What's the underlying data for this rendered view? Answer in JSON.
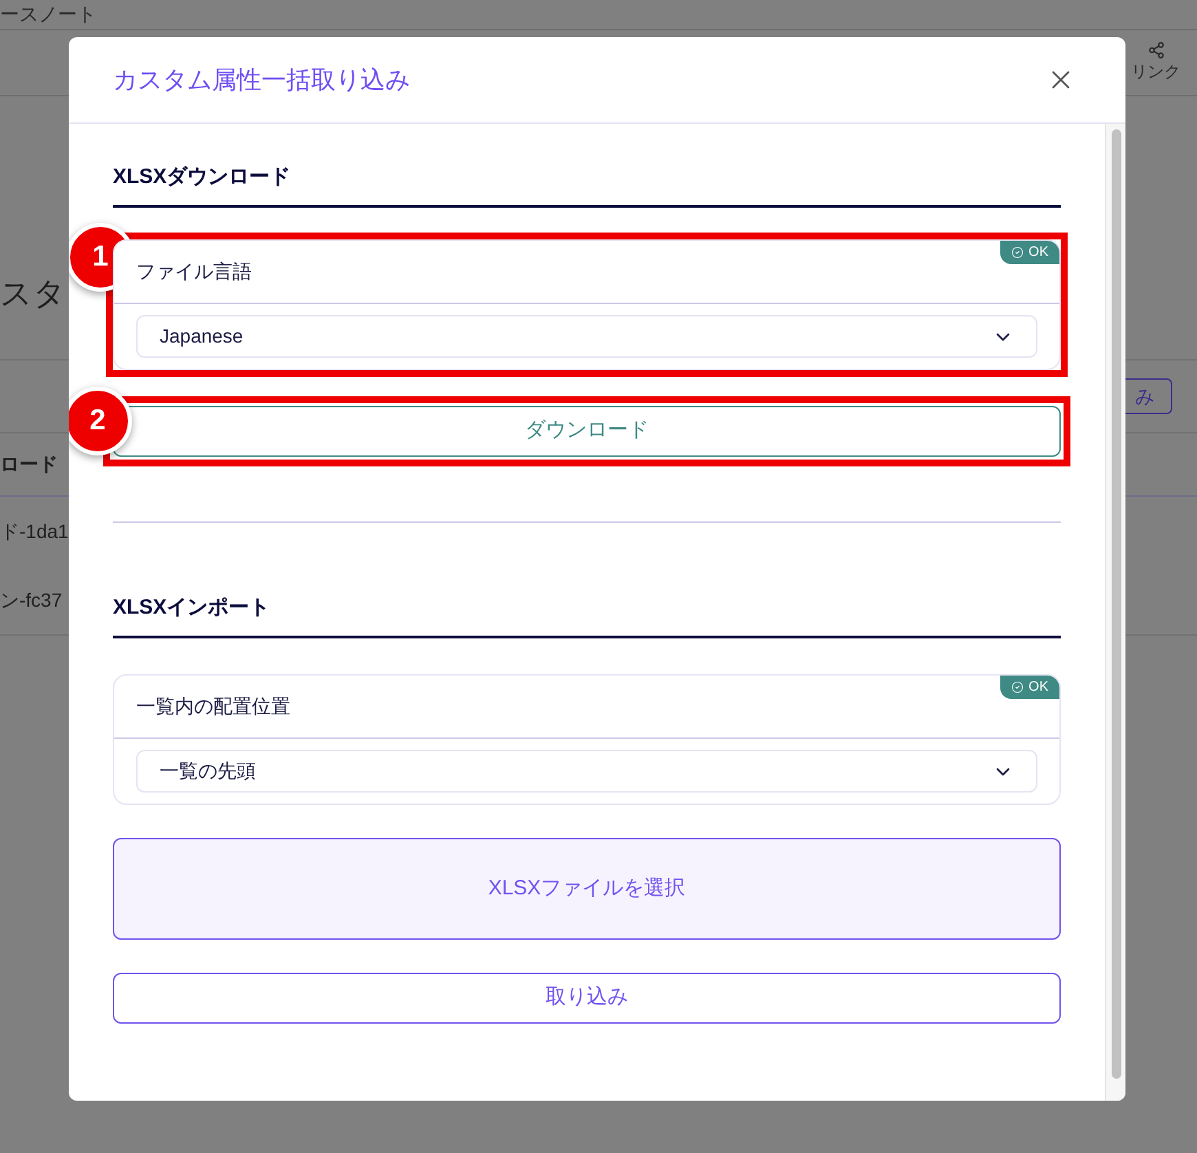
{
  "background": {
    "breadcrumb": "ースノート",
    "share_label": "リンク",
    "heading": "スタ",
    "action_button": "み",
    "table": {
      "column_header": "ロード",
      "rows": [
        "ド-1da1",
        "ン-fc37"
      ]
    }
  },
  "dialog": {
    "title": "カスタム属性一括取り込み",
    "sections": [
      {
        "heading": "XLSXダウンロード",
        "field": {
          "label": "ファイル言語",
          "status": "OK",
          "value": "Japanese",
          "annotation": "1"
        },
        "button": {
          "label": "ダウンロード",
          "kind": "secondary",
          "annotation": "2"
        }
      },
      {
        "heading": "XLSXインポート",
        "field": {
          "label": "一覧内の配置位置",
          "status": "OK",
          "value": "一覧の先頭"
        },
        "dropzone": "XLSXファイルを選択",
        "button": {
          "label": "取り込み",
          "kind": "primary"
        }
      }
    ]
  }
}
